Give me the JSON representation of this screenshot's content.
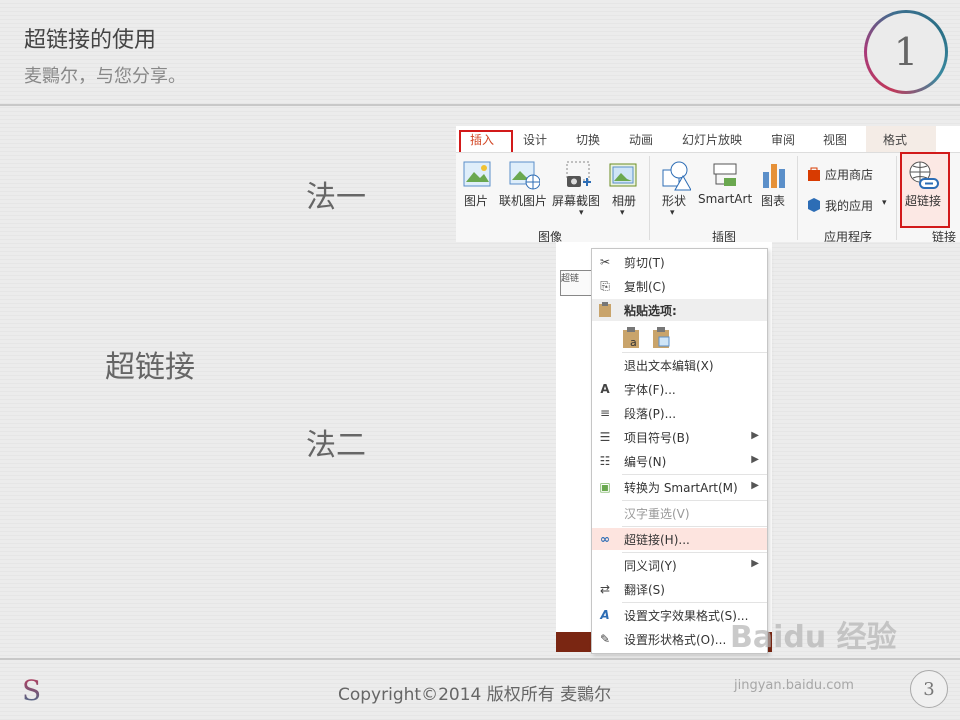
{
  "slide": {
    "title": "超链接的使用",
    "subtitle": "麦䴉尔，与您分享。",
    "number_badge": "1",
    "main_label": "超链接",
    "method1": "法一",
    "method2": "法二",
    "footer_logo": "S",
    "copyright": "Copyright©2014 版权所有 麦䴉尔",
    "page_number": "3"
  },
  "ribbon": {
    "tabs": [
      "插入",
      "设计",
      "切换",
      "动画",
      "幻灯片放映",
      "审阅",
      "视图",
      "格式"
    ],
    "active_tab": "插入",
    "buttons": {
      "picture": "图片",
      "online_picture": "联机图片",
      "screenshot": "屏幕截图",
      "album": "相册",
      "shapes": "形状",
      "smartart": "SmartArt",
      "chart": "图表",
      "store": "应用商店",
      "my_apps": "我的应用",
      "hyperlink": "超链接"
    },
    "groups": {
      "images": "图像",
      "illustrations": "插图",
      "apps": "应用程序",
      "links": "链接"
    },
    "dropdown_arrow": "▾"
  },
  "textbox_thumb": "超链",
  "context_menu": {
    "items": [
      {
        "label": "剪切(T)",
        "icon": "scissors-icon",
        "glyph": "✂"
      },
      {
        "label": "复制(C)",
        "icon": "copy-icon",
        "glyph": "⎘"
      },
      {
        "label": "粘贴选项:",
        "icon": "paste-icon",
        "glyph": "📋"
      },
      {
        "label": "退出文本编辑(X)",
        "icon": "",
        "glyph": ""
      },
      {
        "label": "字体(F)...",
        "icon": "font-icon",
        "glyph": "A"
      },
      {
        "label": "段落(P)...",
        "icon": "paragraph-icon",
        "glyph": "≡"
      },
      {
        "label": "项目符号(B)",
        "icon": "bullets-icon",
        "glyph": "☰"
      },
      {
        "label": "编号(N)",
        "icon": "numbering-icon",
        "glyph": "☷"
      },
      {
        "label": "转换为 SmartArt(M)",
        "icon": "smartart-icon",
        "glyph": "▣"
      },
      {
        "label": "汉字重选(V)",
        "icon": "",
        "glyph": ""
      },
      {
        "label": "超链接(H)...",
        "icon": "hyperlink-icon",
        "glyph": "∞"
      },
      {
        "label": "同义词(Y)",
        "icon": "",
        "glyph": ""
      },
      {
        "label": "翻译(S)",
        "icon": "translate-icon",
        "glyph": "⇄"
      },
      {
        "label": "设置文字效果格式(S)...",
        "icon": "text-effects-icon",
        "glyph": "A"
      },
      {
        "label": "设置形状格式(O)...",
        "icon": "shape-format-icon",
        "glyph": "✎"
      }
    ],
    "submenu_arrow": "▶"
  },
  "watermark": {
    "text": "Baidu 经验",
    "url": "jingyan.baidu.com"
  },
  "colors": {
    "accent": "#d24726",
    "highlight_border": "#d21a1a",
    "menu_highlight": "#fde4df"
  }
}
